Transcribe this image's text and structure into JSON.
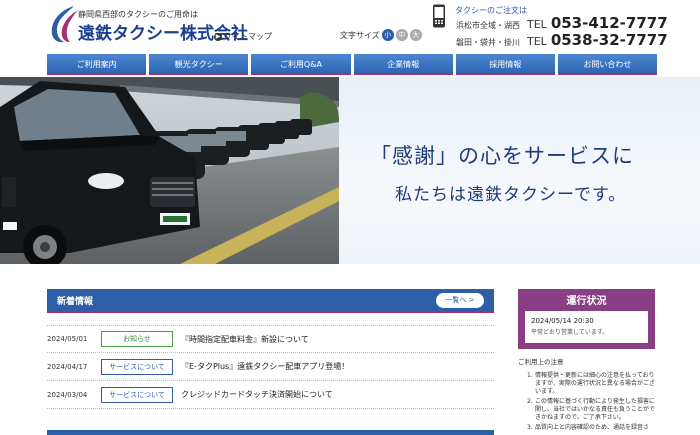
{
  "header": {
    "tagline": "静岡県西部のタクシーのご用命は",
    "company": "遠鉄タクシー株式会社",
    "sitemap": "サイトマップ",
    "font_size_label": "文字サイズ",
    "font_sizes": [
      "小",
      "中",
      "大"
    ],
    "order_label": "タクシーのご注文は",
    "tel": [
      {
        "area": "浜松市全域・湖西",
        "label": "TEL",
        "number": "053-412-7777"
      },
      {
        "area": "磐田・袋井・掛川",
        "label": "TEL",
        "number": "0538-32-7777"
      }
    ]
  },
  "nav": {
    "items": [
      "ご利用案内",
      "観光タクシー",
      "ご利用Q&A",
      "企業情報",
      "採用情報",
      "お問い合わせ"
    ]
  },
  "hero": {
    "line1": "「感謝」の心をサービスに",
    "line2": "私たちは遠鉄タクシーです。"
  },
  "news": {
    "title": "新着情報",
    "more": "一覧へ",
    "items": [
      {
        "date": "2024/05/01",
        "tag": "お知らせ",
        "text": "『時間指定配車料金』新設について"
      },
      {
        "date": "2024/04/17",
        "tag": "サービスについて",
        "text": "『E-タクPlus』遠鉄タクシー配車アプリ登場！"
      },
      {
        "date": "2024/03/04",
        "tag": "サービスについて",
        "text": "クレジッドカードタッチ決済開始について"
      }
    ]
  },
  "status": {
    "title": "運行状況",
    "time": "2024/05/14 20:30",
    "message": "平常どおり営業しています。"
  },
  "notes": {
    "title": "ご利用上の注意",
    "items": [
      {
        "n": "1.",
        "text": "情報提供・更新には細心の注意を払っておりますが、実際の運行状況と異なる場合がございます。"
      },
      {
        "n": "2.",
        "text": "この情報に基づく行動により発生した損害に関し、当社ではいかなる責任も負うことができかねますので、ご了承下さい。"
      },
      {
        "n": "3.",
        "text": "品質向上と内容確認のため、通話を録音さ"
      }
    ]
  },
  "colors": {
    "brand_blue": "#2d5fa8",
    "accent_magenta": "#a62f72",
    "status_purple": "#8a3f85",
    "company_navy": "#1d3e8f"
  }
}
